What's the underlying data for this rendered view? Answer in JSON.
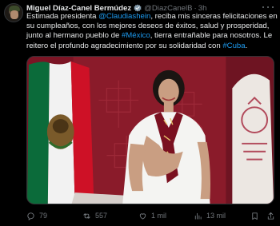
{
  "post": {
    "author_name": "Miguel Díaz-Canel Bermúdez",
    "handle": "@DiazCanelB",
    "separator": "·",
    "time": "3h",
    "text_lines": [
      [
        {
          "t": "Estimada presidenta "
        },
        {
          "t": "@Claudiashein",
          "kind": "mention"
        },
        {
          "t": ", reciba mis sinceras felicitaciones en"
        }
      ],
      [
        {
          "t": "su cumpleaños, con los mejores deseos de éxitos, salud y prosperidad,"
        }
      ],
      [
        {
          "t": "junto al hermano pueblo de "
        },
        {
          "t": "#México",
          "kind": "hashtag"
        },
        {
          "t": ", tierra entrañable para nosotros. Le"
        }
      ],
      [
        {
          "t": "reitero el profundo agradecimiento por su solidaridad con "
        },
        {
          "t": "#Cuba",
          "kind": "hashtag"
        },
        {
          "t": "."
        }
      ]
    ]
  },
  "media": {
    "description_icon": "photo",
    "colors": {
      "background": "#8a1b2a",
      "flag_green": "#0b6b3a",
      "flag_white": "#f2f2f2",
      "flag_red": "#ce1126",
      "dress": "#f4f4f2",
      "scarf": "#7a1020"
    }
  },
  "actions": {
    "replies": "79",
    "reposts": "557",
    "likes": "1 mil",
    "views": "13 mil"
  },
  "colors": {
    "accent": "#1d9bf0",
    "text": "#e7e9ea",
    "muted": "#71767b"
  }
}
